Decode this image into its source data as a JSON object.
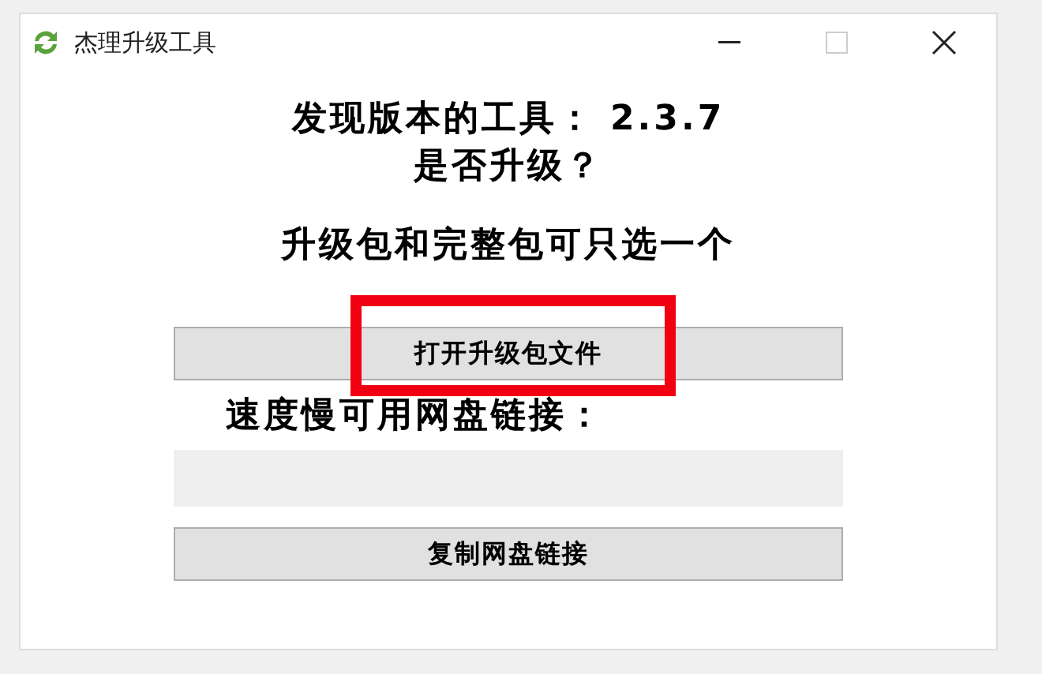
{
  "window": {
    "title": "杰理升级工具"
  },
  "messages": [
    "发现版本的工具： 2.3.7",
    "是否升级？",
    "升级包和完整包可只选一个"
  ],
  "open_button": {
    "label": "打开升级包文件",
    "highlighted": true
  },
  "link_label": "速度慢可用网盘链接：",
  "copy_button": {
    "label": "复制网盘链接"
  }
}
